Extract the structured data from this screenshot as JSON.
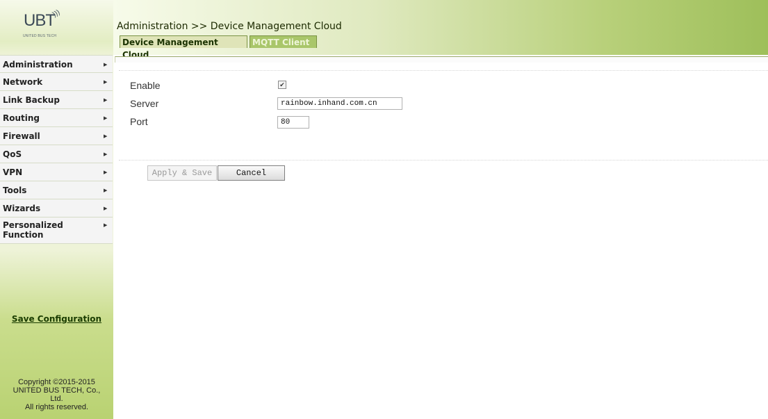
{
  "brand": {
    "logo_text": "UBT",
    "logo_subtitle": "UNITED BUS TECH"
  },
  "sidebar": {
    "items": [
      {
        "label": "Administration"
      },
      {
        "label": "Network"
      },
      {
        "label": "Link Backup"
      },
      {
        "label": "Routing"
      },
      {
        "label": "Firewall"
      },
      {
        "label": "QoS"
      },
      {
        "label": "VPN"
      },
      {
        "label": "Tools"
      },
      {
        "label": "Wizards"
      },
      {
        "label": "Personalized Function"
      }
    ],
    "arrow_glyph": "▶",
    "save_configuration": "Save Configuration",
    "copyright_lines": [
      "Copyright ©2015-2015",
      "UNITED BUS TECH, Co.,",
      "Ltd.",
      "All rights reserved."
    ]
  },
  "header": {
    "breadcrumb": "Administration >> Device Management Cloud",
    "tabs": [
      {
        "label": "Device Management Cloud",
        "active": true
      },
      {
        "label": "MQTT Client",
        "active": false
      }
    ]
  },
  "form": {
    "enable_label": "Enable",
    "enable_checked": true,
    "check_glyph": "✔",
    "server_label": "Server",
    "server_value": "rainbow.inhand.com.cn",
    "port_label": "Port",
    "port_value": "80",
    "apply_label": "Apply & Save",
    "cancel_label": "Cancel"
  },
  "colors": {
    "accent_green": "#9ebf5a",
    "tab_active_bg": "#dfe4b8",
    "tab_inactive_bg": "#a9c66a"
  }
}
